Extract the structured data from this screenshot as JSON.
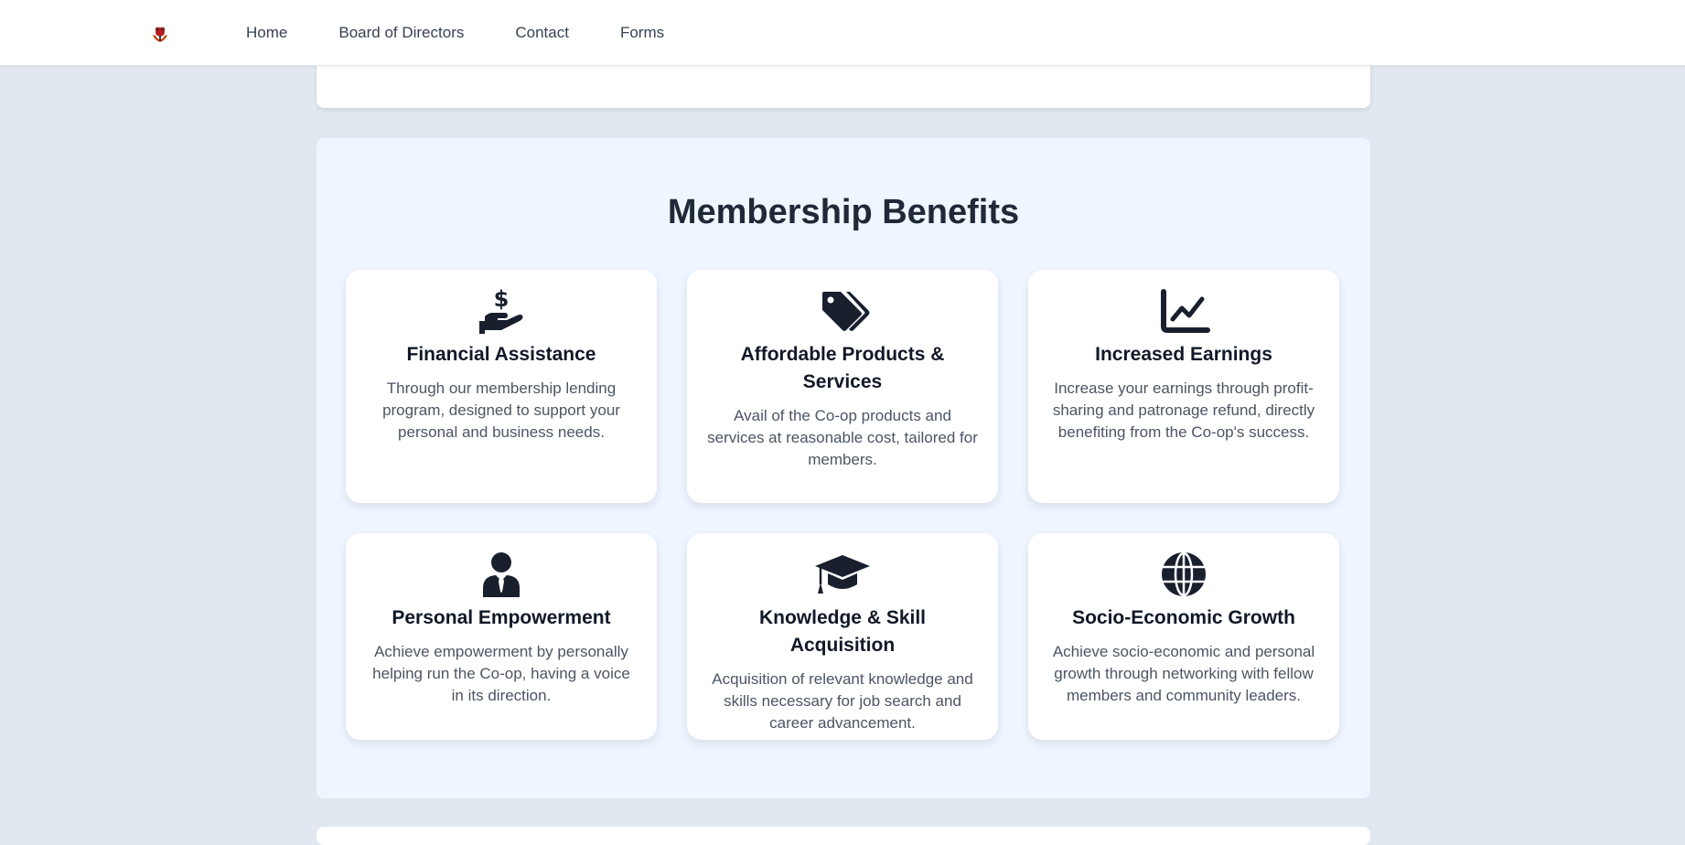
{
  "nav": {
    "items": [
      {
        "label": "Home"
      },
      {
        "label": "Board of Directors"
      },
      {
        "label": "Contact"
      },
      {
        "label": "Forms"
      }
    ]
  },
  "benefits": {
    "title": "Membership Benefits",
    "cards": [
      {
        "icon": "hand-holding-dollar-icon",
        "title": "Financial Assistance",
        "description": "Through our membership lending program, designed to support your personal and business needs."
      },
      {
        "icon": "tags-icon",
        "title": "Affordable Products & Services",
        "description": "Avail of the Co-op products and services at reasonable cost, tailored for members."
      },
      {
        "icon": "chart-line-icon",
        "title": "Increased Earnings",
        "description": "Increase your earnings through profit-sharing and patronage refund, directly benefiting from the Co-op's success."
      },
      {
        "icon": "user-tie-icon",
        "title": "Personal Empowerment",
        "description": "Achieve empowerment by personally helping run the Co-op, having a voice in its direction."
      },
      {
        "icon": "graduation-cap-icon",
        "title": "Knowledge & Skill Acquisition",
        "description": "Acquisition of relevant knowledge and skills necessary for job search and career advancement."
      },
      {
        "icon": "globe-icon",
        "title": "Socio-Economic Growth",
        "description": "Achieve socio-economic and personal growth through networking with fellow members and community leaders."
      }
    ]
  },
  "colors": {
    "page_bg": "#e2e8f0",
    "section_bg": "#eff6ff",
    "icon": "#1a1f2e",
    "text_dark": "#111827",
    "text_muted": "#4b5563"
  }
}
